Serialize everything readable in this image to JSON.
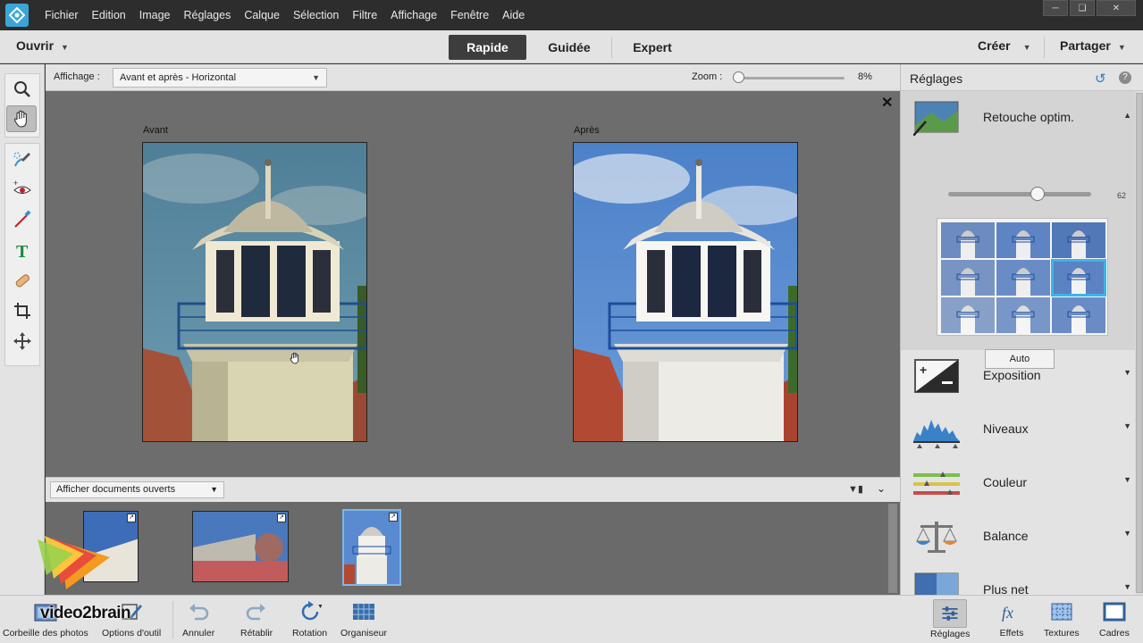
{
  "menubar": {
    "items": [
      "Fichier",
      "Edition",
      "Image",
      "Réglages",
      "Calque",
      "Sélection",
      "Filtre",
      "Affichage",
      "Fenêtre",
      "Aide"
    ]
  },
  "modebar": {
    "open_label": "Ouvrir",
    "tabs": [
      "Rapide",
      "Guidée",
      "Expert"
    ],
    "active_tab": "Rapide",
    "create_label": "Créer",
    "share_label": "Partager"
  },
  "viewbar": {
    "view_label": "Affichage :",
    "view_value": "Avant et après - Horizontal",
    "zoom_label": "Zoom :",
    "zoom_value": "8%",
    "zoom_fraction": 0.02
  },
  "canvas": {
    "before_label": "Avant",
    "after_label": "Après"
  },
  "docs": {
    "select_value": "Afficher documents ouverts"
  },
  "panel": {
    "title": "Réglages",
    "smartfix_label": "Retouche optim.",
    "smartfix_value": "62",
    "auto_label": "Auto",
    "sections": [
      "Exposition",
      "Niveaux",
      "Couleur",
      "Balance",
      "Plus net"
    ]
  },
  "bottombar": {
    "left": [
      "Corbeille des photos",
      "Options d'outil",
      "Annuler",
      "Rétablir",
      "Rotation",
      "Organiseur"
    ],
    "right": [
      "Réglages",
      "Effets",
      "Textures",
      "Cadres"
    ]
  },
  "watermark": "video2brain",
  "colors": {
    "accent": "#3ab5e8",
    "active_tab": "#3d3d3d",
    "canvas": "#6d6d6d"
  }
}
